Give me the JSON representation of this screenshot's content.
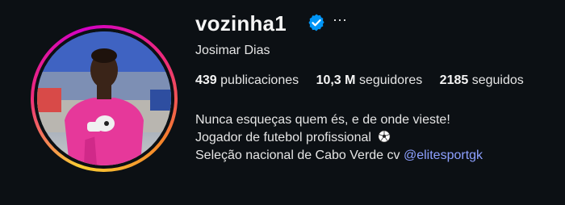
{
  "profile": {
    "username": "vozinha1",
    "full_name": "Josimar Dias",
    "verified_icon": "verified-badge-icon",
    "more_icon": "more-options-icon",
    "more_glyph": "···"
  },
  "stats": {
    "posts_count": "439",
    "posts_label": "publicaciones",
    "followers_count": "10,3 M",
    "followers_label": "seguidores",
    "following_count": "2185",
    "following_label": "seguidos"
  },
  "bio": {
    "line1": "Nunca esqueças quem és, e de onde vieste!",
    "line2": "Jogador de futebol profissional",
    "line2_icon": "soccer-ball-icon",
    "line3": "Seleção nacional de Cabo Verde cv",
    "mention": "@elitesportgk"
  },
  "colors": {
    "background": "#0c1014",
    "text": "#f5f5f5",
    "link": "#8da0ff",
    "verified": "#0095f6"
  }
}
